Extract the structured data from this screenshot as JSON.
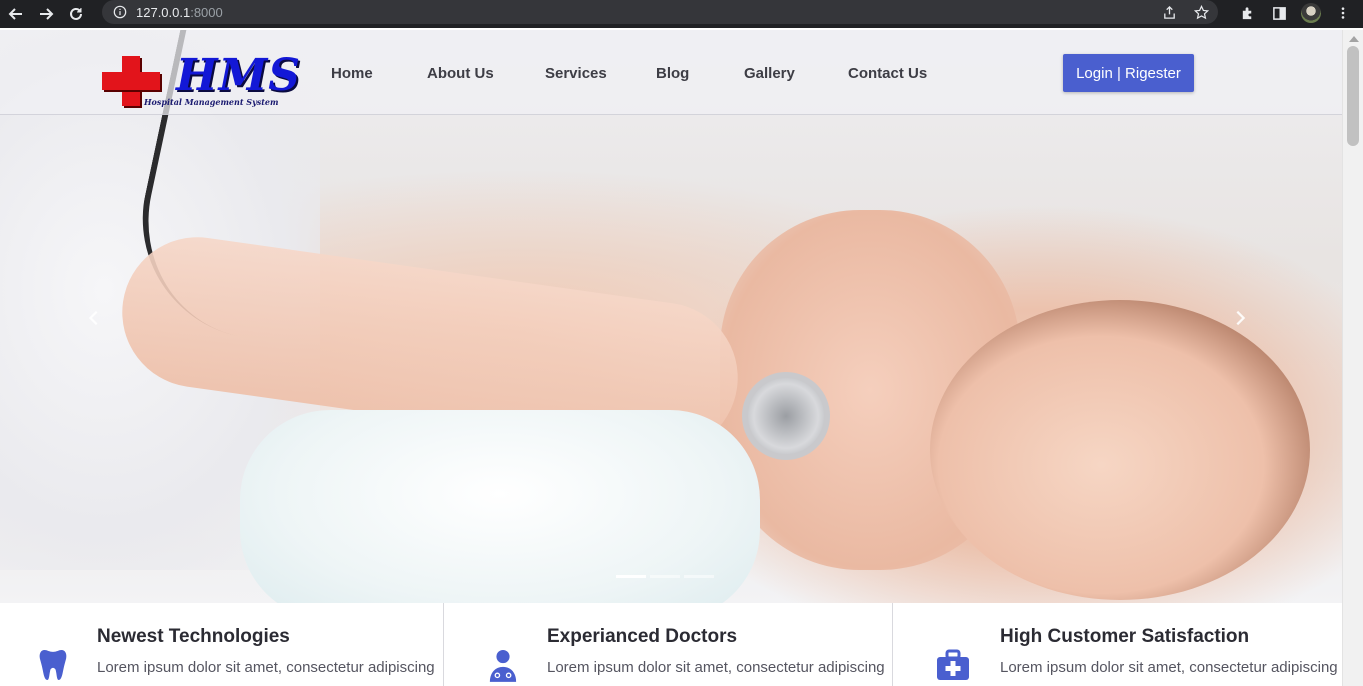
{
  "browser": {
    "url_host": "127.0.0.1",
    "url_port": ":8000"
  },
  "header": {
    "logo_text": "HMS",
    "logo_subtitle": "Hospital Management System",
    "nav": [
      "Home",
      "About Us",
      "Services",
      "Blog",
      "Gallery",
      "Contact Us"
    ],
    "login_label": "Login | Rigester"
  },
  "hero": {
    "slides": 3,
    "active_slide": 1
  },
  "features": [
    {
      "title": "Newest Technologies",
      "text": "Lorem ipsum dolor sit amet, consectetur adipiscing",
      "icon": "tooth-icon"
    },
    {
      "title": "Experianced Doctors",
      "text": "Lorem ipsum dolor sit amet, consectetur adipiscing",
      "icon": "doctor-icon"
    },
    {
      "title": "High Customer Satisfaction",
      "text": "Lorem ipsum dolor sit amet, consectetur adipiscing",
      "icon": "medkit-icon"
    }
  ],
  "colors": {
    "accent": "#4a5fcf",
    "chrome": "#202124",
    "logo_red": "#e2141b",
    "logo_blue": "#1318d6"
  }
}
